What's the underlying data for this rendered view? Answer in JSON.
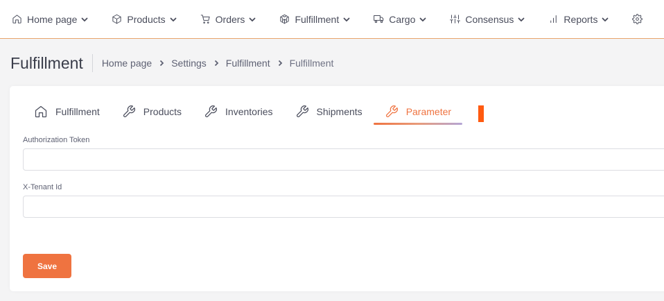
{
  "topnav": {
    "items": [
      {
        "label": "Home page",
        "icon": "home-icon"
      },
      {
        "label": "Products",
        "icon": "box-icon"
      },
      {
        "label": "Orders",
        "icon": "cart-icon"
      },
      {
        "label": "Fulfillment",
        "icon": "codesandbox-icon"
      },
      {
        "label": "Cargo",
        "icon": "truck-icon"
      },
      {
        "label": "Consensus",
        "icon": "sliders-icon"
      },
      {
        "label": "Reports",
        "icon": "bar-chart-icon"
      }
    ],
    "trailing_icon": "gear-icon"
  },
  "header": {
    "title": "Fulfillment",
    "breadcrumb": [
      "Home page",
      "Settings",
      "Fulfillment",
      "Fulfillment"
    ]
  },
  "tabs": [
    {
      "label": "Fulfillment",
      "icon": "home-icon",
      "active": false
    },
    {
      "label": "Products",
      "icon": "wrench-icon",
      "active": false
    },
    {
      "label": "Inventories",
      "icon": "wrench-icon",
      "active": false
    },
    {
      "label": "Shipments",
      "icon": "wrench-icon",
      "active": false
    },
    {
      "label": "Parameter",
      "icon": "wrench-icon",
      "active": true
    }
  ],
  "form": {
    "auth_token": {
      "label": "Authorization Token",
      "value": ""
    },
    "tenant_id": {
      "label": "X-Tenant Id",
      "value": ""
    },
    "save_label": "Save"
  },
  "colors": {
    "accent": "#ef7340",
    "marker": "#ff5a10",
    "nav_border": "#e8a36b"
  }
}
